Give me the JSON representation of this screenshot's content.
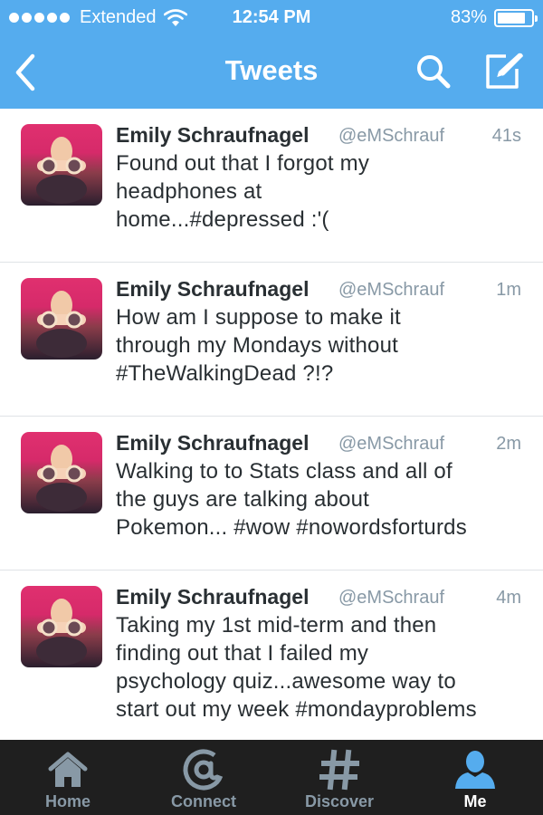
{
  "status_bar": {
    "carrier": "Extended",
    "time": "12:54 PM",
    "battery": "83%",
    "battery_level": 0.83
  },
  "nav": {
    "title": "Tweets",
    "back_icon": "chevron-left-icon",
    "search_icon": "search-icon",
    "compose_icon": "compose-icon"
  },
  "tweets": [
    {
      "name": "Emily Schraufnagel",
      "handle": "@eMSchrauf",
      "time": "41s",
      "lines": [
        "Found out that I forgot my",
        "headphones at",
        "home...#depressed :'("
      ]
    },
    {
      "name": "Emily Schraufnagel",
      "handle": "@eMSchrauf",
      "time": "1m",
      "lines": [
        "How am I suppose to make it",
        "through my Mondays without",
        "#TheWalkingDead ?!?"
      ]
    },
    {
      "name": "Emily Schraufnagel",
      "handle": "@eMSchrauf",
      "time": "2m",
      "lines": [
        "Walking to to Stats class and all of",
        "the guys are talking about",
        "Pokemon... #wow #nowordsforturds"
      ]
    },
    {
      "name": "Emily Schraufnagel",
      "handle": "@eMSchrauf",
      "time": "4m",
      "lines": [
        "Taking my 1st mid-term and then",
        "finding out that I failed my",
        "psychology quiz...awesome way to",
        "start out my week #mondayproblems"
      ]
    }
  ],
  "tabs": [
    {
      "label": "Home",
      "icon": "home-icon",
      "active": false
    },
    {
      "label": "Connect",
      "icon": "at-sign-icon",
      "active": false
    },
    {
      "label": "Discover",
      "icon": "hashtag-icon",
      "active": false
    },
    {
      "label": "Me",
      "icon": "person-icon",
      "active": true
    }
  ],
  "colors": {
    "brand": "#55acee",
    "tab_bar": "#1f1f1f",
    "tab_inactive": "#8899a6",
    "active_icon": "#55acee"
  }
}
